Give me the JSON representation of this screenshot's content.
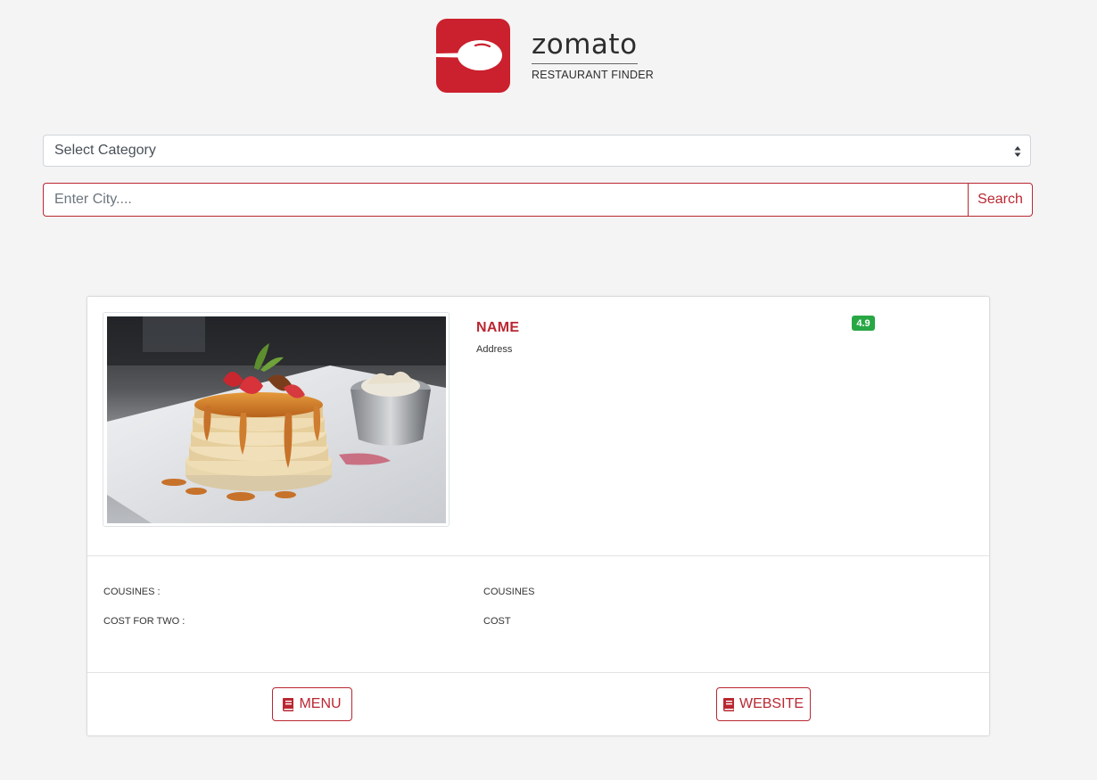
{
  "logo": {
    "wordmark": "zomato",
    "tagline": "RESTAURANT FINDER",
    "icon": "spoon-icon",
    "brand_color": "#cb202d"
  },
  "filters": {
    "category_selected": "Select Category",
    "city_placeholder": "Enter City....",
    "city_value": "",
    "search_label": "Search"
  },
  "restaurant": {
    "image_alt": "pancakes-photo",
    "name": "NAME",
    "address": "Address",
    "rating": "4.9",
    "rating_color": "#28a745",
    "details": [
      {
        "label": "COUSINES :",
        "value": "COUSINES"
      },
      {
        "label": "COST FOR TWO :",
        "value": "COST"
      }
    ],
    "menu_label": "MENU",
    "website_label": "WEBSITE",
    "button_icon": "book-icon",
    "accent_color": "#b92732"
  }
}
